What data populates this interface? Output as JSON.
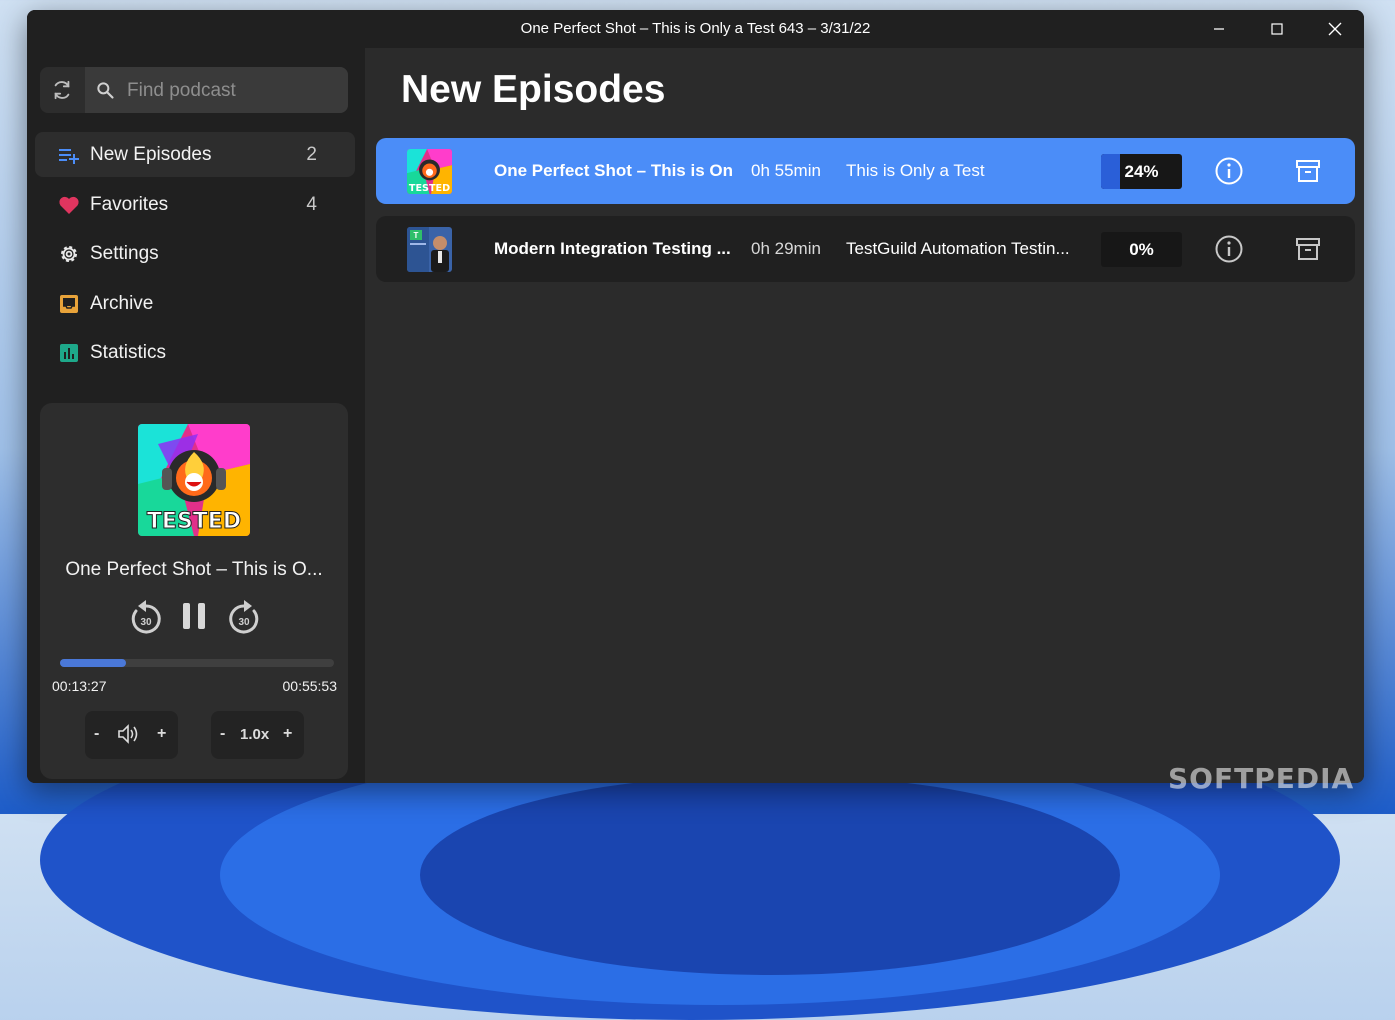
{
  "window": {
    "title": "One Perfect Shot – This is Only a Test 643 – 3/31/22"
  },
  "search": {
    "placeholder": "Find podcast",
    "value": ""
  },
  "nav": [
    {
      "label": "New Episodes",
      "count": "2",
      "icon": "playlist-add-icon",
      "color": "#4b8df8"
    },
    {
      "label": "Favorites",
      "count": "4",
      "icon": "heart-icon",
      "color": "#e0355f"
    },
    {
      "label": "Settings",
      "count": "",
      "icon": "gear-icon",
      "color": "#e8e8e8"
    },
    {
      "label": "Archive",
      "count": "",
      "icon": "inbox-icon",
      "color": "#e8a33a"
    },
    {
      "label": "Statistics",
      "count": "",
      "icon": "bar-chart-icon",
      "color": "#1ea88a"
    }
  ],
  "player": {
    "title": "One Perfect Shot – This is O...",
    "skip_back_seconds": "30",
    "skip_forward_seconds": "30",
    "elapsed": "00:13:27",
    "duration": "00:55:53",
    "progress_fraction": 0.24,
    "volume_minus": "-",
    "volume_plus": "+",
    "speed_minus": "-",
    "speed": "1.0x",
    "speed_plus": "+",
    "cover_text": "TESTED"
  },
  "main": {
    "title": "New Episodes",
    "episodes": [
      {
        "title": "One Perfect Shot – This is On...",
        "duration": "0h 55min",
        "show": "This is Only a Test",
        "progress": "24%",
        "progress_fraction": 0.24,
        "cover_text": "TESTED",
        "active": true
      },
      {
        "title": "Modern Integration Testing ...",
        "duration": "0h 29min",
        "show": "TestGuild Automation Testin...",
        "progress": "0%",
        "progress_fraction": 0,
        "active": false
      }
    ]
  },
  "watermark": "SOFTPEDIA",
  "colors": {
    "accent": "#4b8df8",
    "progress": "#2a5fd8",
    "background": "#202020"
  }
}
